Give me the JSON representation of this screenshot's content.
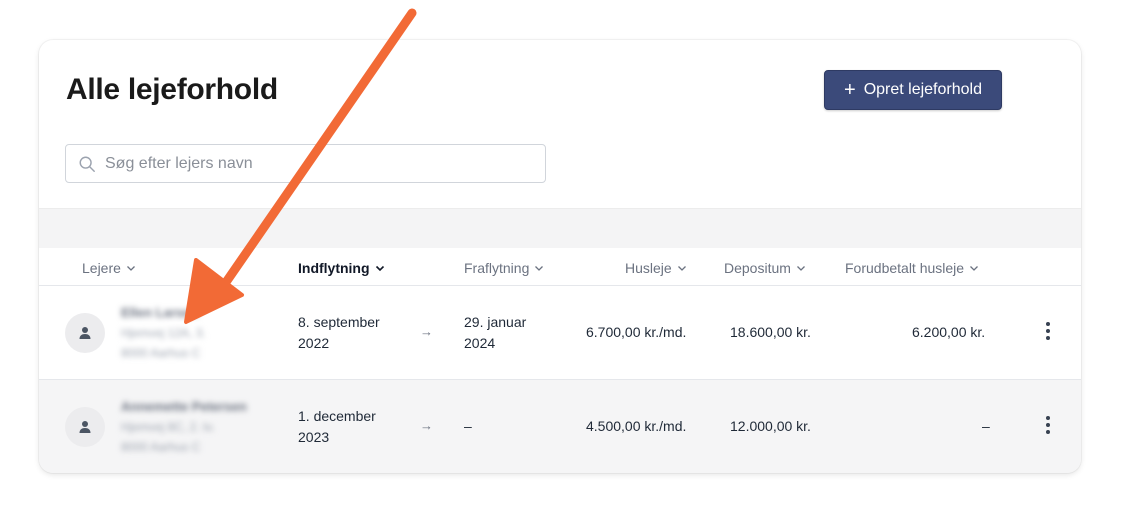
{
  "page": {
    "title": "Alle lejeforhold"
  },
  "actions": {
    "create_label": "Opret lejeforhold",
    "create_icon": "plus-icon"
  },
  "search": {
    "placeholder": "Søg efter lejers navn",
    "value": ""
  },
  "table": {
    "columns": {
      "tenant": "Lejere",
      "move_in": "Indflytning",
      "move_out": "Fraflytning",
      "rent": "Husleje",
      "deposit": "Depositum",
      "prepaid_rent": "Forudbetalt husleje"
    },
    "rows": [
      {
        "tenant_name": "Ellen Larsen",
        "tenant_address": "Hjemvej 12A, 3.",
        "tenant_city": "8000 Aarhus C",
        "move_in_line1": "8. september",
        "move_in_line2": "2022",
        "move_out_line1": "29. januar",
        "move_out_line2": "2024",
        "rent": "6.700,00 kr./md.",
        "deposit": "18.600,00 kr.",
        "prepaid_rent": "6.200,00 kr."
      },
      {
        "tenant_name": "Annemette Petersen",
        "tenant_address": "Hjemvej 8C, 2. tv.",
        "tenant_city": "8000 Aarhus C",
        "move_in_line1": "1. december",
        "move_in_line2": "2023",
        "move_out_line1": "–",
        "move_out_line2": "",
        "rent": "4.500,00 kr./md.",
        "deposit": "12.000,00 kr.",
        "prepaid_rent": "–"
      }
    ]
  },
  "colors": {
    "primary": "#3b4a7a",
    "annotation_arrow": "#f26a36"
  },
  "icons": {
    "search": "search-icon",
    "avatar": "user-icon",
    "sort": "chevron-down-icon",
    "arrow": "arrow-right-icon",
    "menu": "more-vertical-icon"
  },
  "symbols": {
    "plus": "+",
    "arrow_right": "→"
  }
}
